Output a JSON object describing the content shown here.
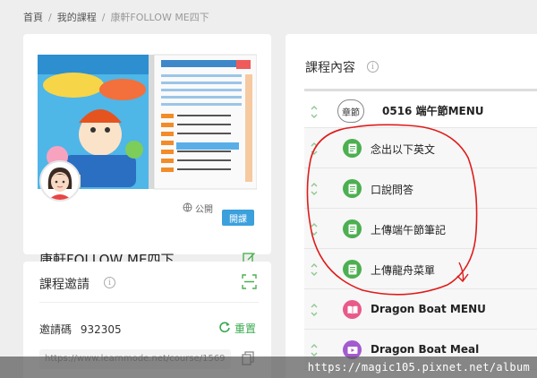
{
  "breadcrumb": {
    "home": "首頁",
    "my_courses": "我的課程",
    "current": "康軒FOLLOW ME四下",
    "separator": "/"
  },
  "course": {
    "title": "康軒FOLLOW ME四下",
    "visibility": "公開",
    "open_class_button": "開課",
    "cover_icon": "book-cover-image",
    "avatar_icon": "teacher-avatar"
  },
  "invite": {
    "title": "課程邀請",
    "code_label": "邀請碼",
    "code_value": "932305",
    "reset_label": "重置",
    "url": "https://www.learnmode.net/course/1569"
  },
  "content": {
    "title": "課程內容",
    "chapter": {
      "badge": "章節",
      "label": "0516 端午節MENU"
    },
    "items": [
      {
        "label": "念出以下英文",
        "icon": "document-icon",
        "color": "#4caf50"
      },
      {
        "label": "口說問答",
        "icon": "document-icon",
        "color": "#4caf50"
      },
      {
        "label": "上傳端午節筆記",
        "icon": "document-icon",
        "color": "#4caf50"
      },
      {
        "label": "上傳龍舟菜單",
        "icon": "document-icon",
        "color": "#4caf50"
      },
      {
        "label": "Dragon Boat MENU",
        "icon": "book-icon",
        "color": "#e85a8a"
      },
      {
        "label": "Dragon Boat Meal",
        "icon": "video-icon",
        "color": "#a35bd0"
      }
    ]
  },
  "watermark": "https://magic105.pixnet.net/album",
  "colors": {
    "accent_blue": "#3ba0dc",
    "accent_green": "#3aa94f",
    "annotation_red": "#e01b1b"
  }
}
